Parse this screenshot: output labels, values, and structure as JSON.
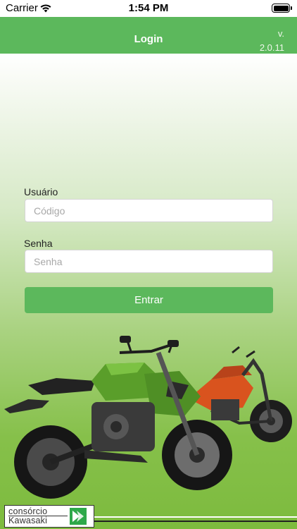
{
  "status_bar": {
    "carrier": "Carrier",
    "time": "1:54 PM"
  },
  "nav": {
    "title": "Login",
    "version_prefix": "v.",
    "version": "2.0.11"
  },
  "form": {
    "username_label": "Usuário",
    "username_placeholder": "Código",
    "username_value": "",
    "password_label": "Senha",
    "password_placeholder": "Senha",
    "password_value": "",
    "submit_label": "Entrar"
  },
  "footer": {
    "logo_line1": "consórcio",
    "logo_line2": "Kawasaki"
  },
  "colors": {
    "brand_green": "#5cb85c",
    "bike_green": "#5a9e2a",
    "bike_orange": "#d9531e"
  },
  "icons": {
    "wifi": "wifi-icon",
    "battery": "battery-icon",
    "logo_mark": "kawasaki-k-mark-icon"
  }
}
